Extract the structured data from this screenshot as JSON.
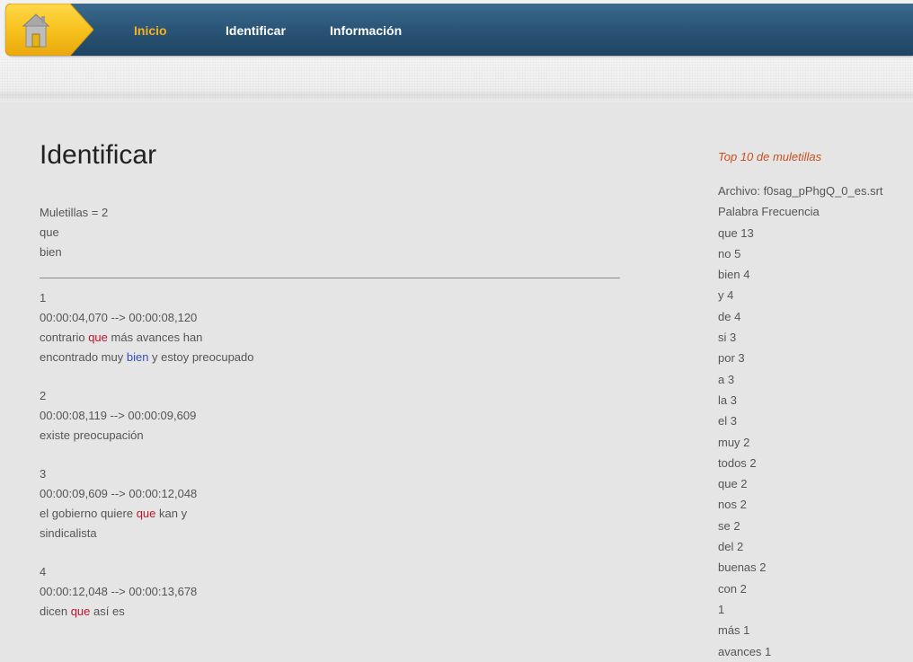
{
  "nav": {
    "home_icon": "home-icon",
    "links": [
      {
        "label": "Inicio",
        "active": true
      },
      {
        "label": "Identificar",
        "active": false
      },
      {
        "label": "Información",
        "active": false
      }
    ],
    "accent_color": "#f7b21c",
    "bar_color": "#2a5476"
  },
  "main": {
    "title": "Identificar",
    "muletillas_count": "Muletillas = 2",
    "muletillas": [
      "que",
      "bien"
    ],
    "entries": [
      {
        "index": "1",
        "time": "00:00:04,070 --> 00:00:08,120",
        "lines": [
          [
            {
              "t": "contrario "
            },
            {
              "t": "que",
              "hl": "que"
            },
            {
              "t": " más avances han"
            }
          ],
          [
            {
              "t": "encontrado muy "
            },
            {
              "t": "bien",
              "hl": "bien"
            },
            {
              "t": " y estoy preocupado"
            }
          ]
        ]
      },
      {
        "index": "2",
        "time": "00:00:08,119 --> 00:00:09,609",
        "lines": [
          [
            {
              "t": "existe preocupación"
            }
          ]
        ]
      },
      {
        "index": "3",
        "time": "00:00:09,609 --> 00:00:12,048",
        "lines": [
          [
            {
              "t": "el gobierno quiere "
            },
            {
              "t": "que",
              "hl": "que"
            },
            {
              "t": " kan y"
            }
          ],
          [
            {
              "t": "sindicalista"
            }
          ]
        ]
      },
      {
        "index": "4",
        "time": "00:00:12,048 --> 00:00:13,678",
        "lines": [
          [
            {
              "t": "dicen "
            },
            {
              "t": "que",
              "hl": "que"
            },
            {
              "t": " así es"
            }
          ]
        ]
      }
    ],
    "highlight_colors": {
      "que": "#c0132f",
      "bien": "#2f4fbf"
    }
  },
  "sidebar": {
    "title": "Top 10 de muletillas",
    "file": "Archivo: f0sag_pPhgQ_0_es.srt",
    "header": "Palabra Frecuencia",
    "rows": [
      "que 13",
      "no 5",
      "bien 4",
      "y 4",
      "de 4",
      "si 3",
      "por 3",
      "a 3",
      "la 3",
      "el 3",
      "muy 2",
      "todos 2",
      "que 2",
      "nos 2",
      "se 2",
      "del 2",
      "buenas 2",
      "con 2",
      "1",
      "más 1",
      "avances 1"
    ],
    "title_color": "#c8501e"
  }
}
